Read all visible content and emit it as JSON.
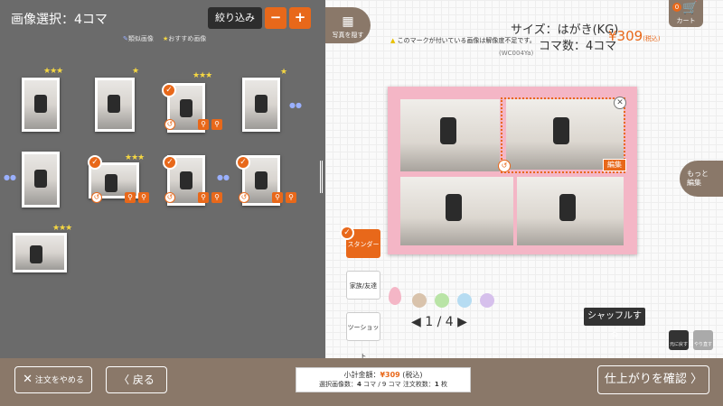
{
  "header": {
    "title": "画像選択：4コマ",
    "filter_label": "絞り込み",
    "zoom_out": "−",
    "zoom_in": "+"
  },
  "legend": {
    "similar": "類似画像",
    "recommended": "おすすめ画像"
  },
  "thumbnails": [
    {
      "stars": "★★★",
      "selected": false
    },
    {
      "stars": "★",
      "selected": false
    },
    {
      "stars": "★★★",
      "selected": true
    },
    {
      "stars": "★",
      "selected": false
    },
    {
      "stars": "",
      "selected": false
    },
    {
      "stars": "★★★",
      "selected": true
    },
    {
      "stars": "",
      "selected": true
    },
    {
      "stars": "",
      "selected": true
    },
    {
      "stars": "★★★",
      "selected": false
    }
  ],
  "right": {
    "hide_label": "写真を隠す",
    "size_label": "サイズ：はがき(KG)",
    "count_label": "コマ数：4コマ",
    "price": "¥309",
    "price_tax": "(税込)",
    "code": "(WC004Ya)",
    "warning": "このマークが付いている画像は解像度不足です。",
    "cart_label": "カート",
    "cart_count": "0",
    "edit_label": "編集",
    "more_edit": "もっと\n編集",
    "layouts": [
      "スタンダード",
      "家族/友達",
      "ツーショット"
    ],
    "colors": [
      "#f4b6c6",
      "#d9c3ac",
      "#b9e4a6",
      "#b6dcf2",
      "#d6c0ec"
    ],
    "pager": "◀ 1 / 4 ▶",
    "shuffle": "シャッフルする",
    "undo": "元に戻す",
    "redo": "やり直す"
  },
  "bottom": {
    "cancel": "注文をやめる",
    "back": "戻る",
    "subtotal_label": "小計金額：",
    "subtotal_price": "¥309",
    "subtotal_tax": "(税込)",
    "selected_info": "選択画像数：",
    "selected_count": "4",
    "selected_total": "コマ / 9 コマ",
    "order_label": "注文枚数：",
    "order_count": "1",
    "order_unit": "枚",
    "confirm": "仕上がりを確認"
  }
}
